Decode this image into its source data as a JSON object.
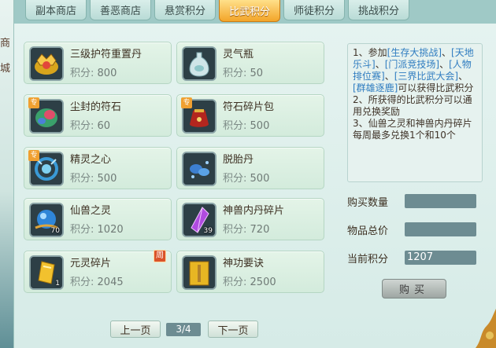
{
  "left_strip": {
    "chars": [
      "商",
      "城"
    ]
  },
  "tabs": [
    {
      "label": "副本商店",
      "active": false
    },
    {
      "label": "善恶商店",
      "active": false
    },
    {
      "label": "悬赏积分",
      "active": false
    },
    {
      "label": "比武积分",
      "active": true
    },
    {
      "label": "师徒积分",
      "active": false
    },
    {
      "label": "挑战积分",
      "active": false
    }
  ],
  "points_label": "积分:",
  "items": [
    {
      "name": "三级护符重置丹",
      "points": "800",
      "icon": "gold-charm-icon"
    },
    {
      "name": "灵气瓶",
      "points": "50",
      "icon": "spirit-vase-icon"
    },
    {
      "name": "尘封的符石",
      "points": "60",
      "icon": "rune-stone-icon",
      "badge": "专"
    },
    {
      "name": "符石碎片包",
      "points": "500",
      "icon": "rune-pouch-icon",
      "badge": "专"
    },
    {
      "name": "精灵之心",
      "points": "500",
      "icon": "spirit-heart-icon",
      "badge": "专"
    },
    {
      "name": "脱胎丹",
      "points": "500",
      "icon": "rebirth-pill-icon"
    },
    {
      "name": "仙兽之灵",
      "points": "1020",
      "icon": "beast-soul-orb-icon",
      "count": "70"
    },
    {
      "name": "神兽内丹碎片",
      "points": "720",
      "icon": "purple-crystal-icon",
      "count": "39"
    },
    {
      "name": "元灵碎片",
      "points": "2045",
      "icon": "gold-shard-icon",
      "count": "1",
      "weekly": "周"
    },
    {
      "name": "神功要诀",
      "points": "2500",
      "icon": "skill-book-icon"
    }
  ],
  "info": {
    "l1_pre": "1、参加",
    "l1_links": [
      "[生存大挑战]",
      "[天地乐斗]",
      "[门派竞技场]",
      "[人物排位赛]",
      "[三界比武大会]",
      "[群雄逐鹿]"
    ],
    "sep": "、",
    "l1_post": "可以获得比武积分",
    "l2": "2、所获得的比武积分可以通用兑换奖励",
    "l3": "3、仙兽之灵和神兽内丹碎片每周最多兑换1个和10个"
  },
  "form": {
    "qty_label": "购买数量",
    "qty_value": "",
    "total_label": "物品总价",
    "total_value": "",
    "current_label": "当前积分",
    "current_value": "1207"
  },
  "buy_label": "购买",
  "pager": {
    "prev": "上一页",
    "page": "3/4",
    "next": "下一页"
  }
}
